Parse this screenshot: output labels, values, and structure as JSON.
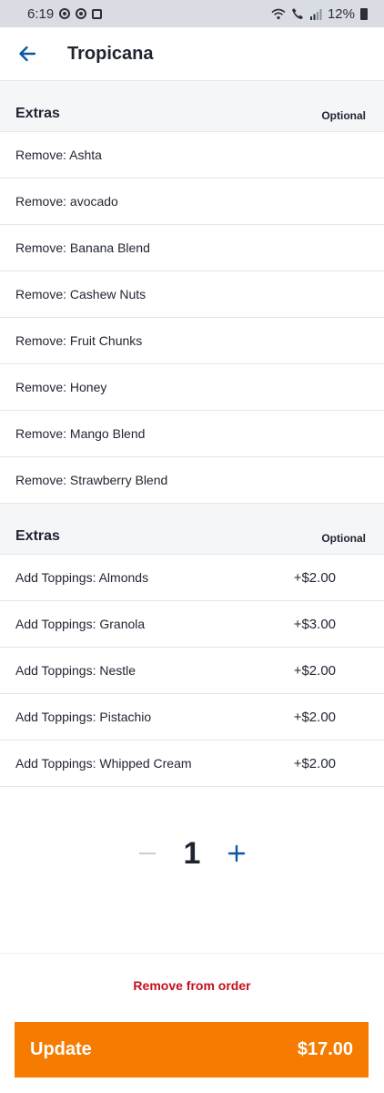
{
  "status_bar": {
    "time": "6:19",
    "battery": "12%"
  },
  "app_bar": {
    "title": "Tropicana",
    "back_icon": "arrow-left-icon"
  },
  "colors": {
    "accent_blue": "#0b57a4",
    "primary_orange": "#f57c00",
    "danger_red": "#c40f1d"
  },
  "sections": [
    {
      "title": "Extras",
      "badge": "Optional",
      "options": [
        {
          "label": "Remove: Ashta"
        },
        {
          "label": "Remove: avocado"
        },
        {
          "label": "Remove: Banana Blend"
        },
        {
          "label": "Remove: Cashew Nuts"
        },
        {
          "label": "Remove: Fruit Chunks"
        },
        {
          "label": "Remove: Honey"
        },
        {
          "label": "Remove: Mango Blend"
        },
        {
          "label": "Remove: Strawberry Blend"
        }
      ]
    },
    {
      "title": "Extras",
      "badge": "Optional",
      "options": [
        {
          "label": "Add Toppings: Almonds",
          "price": "+$2.00"
        },
        {
          "label": "Add Toppings: Granola",
          "price": "+$3.00"
        },
        {
          "label": "Add Toppings: Nestle",
          "price": "+$2.00"
        },
        {
          "label": "Add Toppings: Pistachio",
          "price": "+$2.00"
        },
        {
          "label": "Add Toppings: Whipped Cream",
          "price": "+$2.00"
        }
      ]
    }
  ],
  "quantity": {
    "value": "1"
  },
  "footer": {
    "remove_label": "Remove from order",
    "update_label": "Update",
    "update_price": "$17.00"
  }
}
